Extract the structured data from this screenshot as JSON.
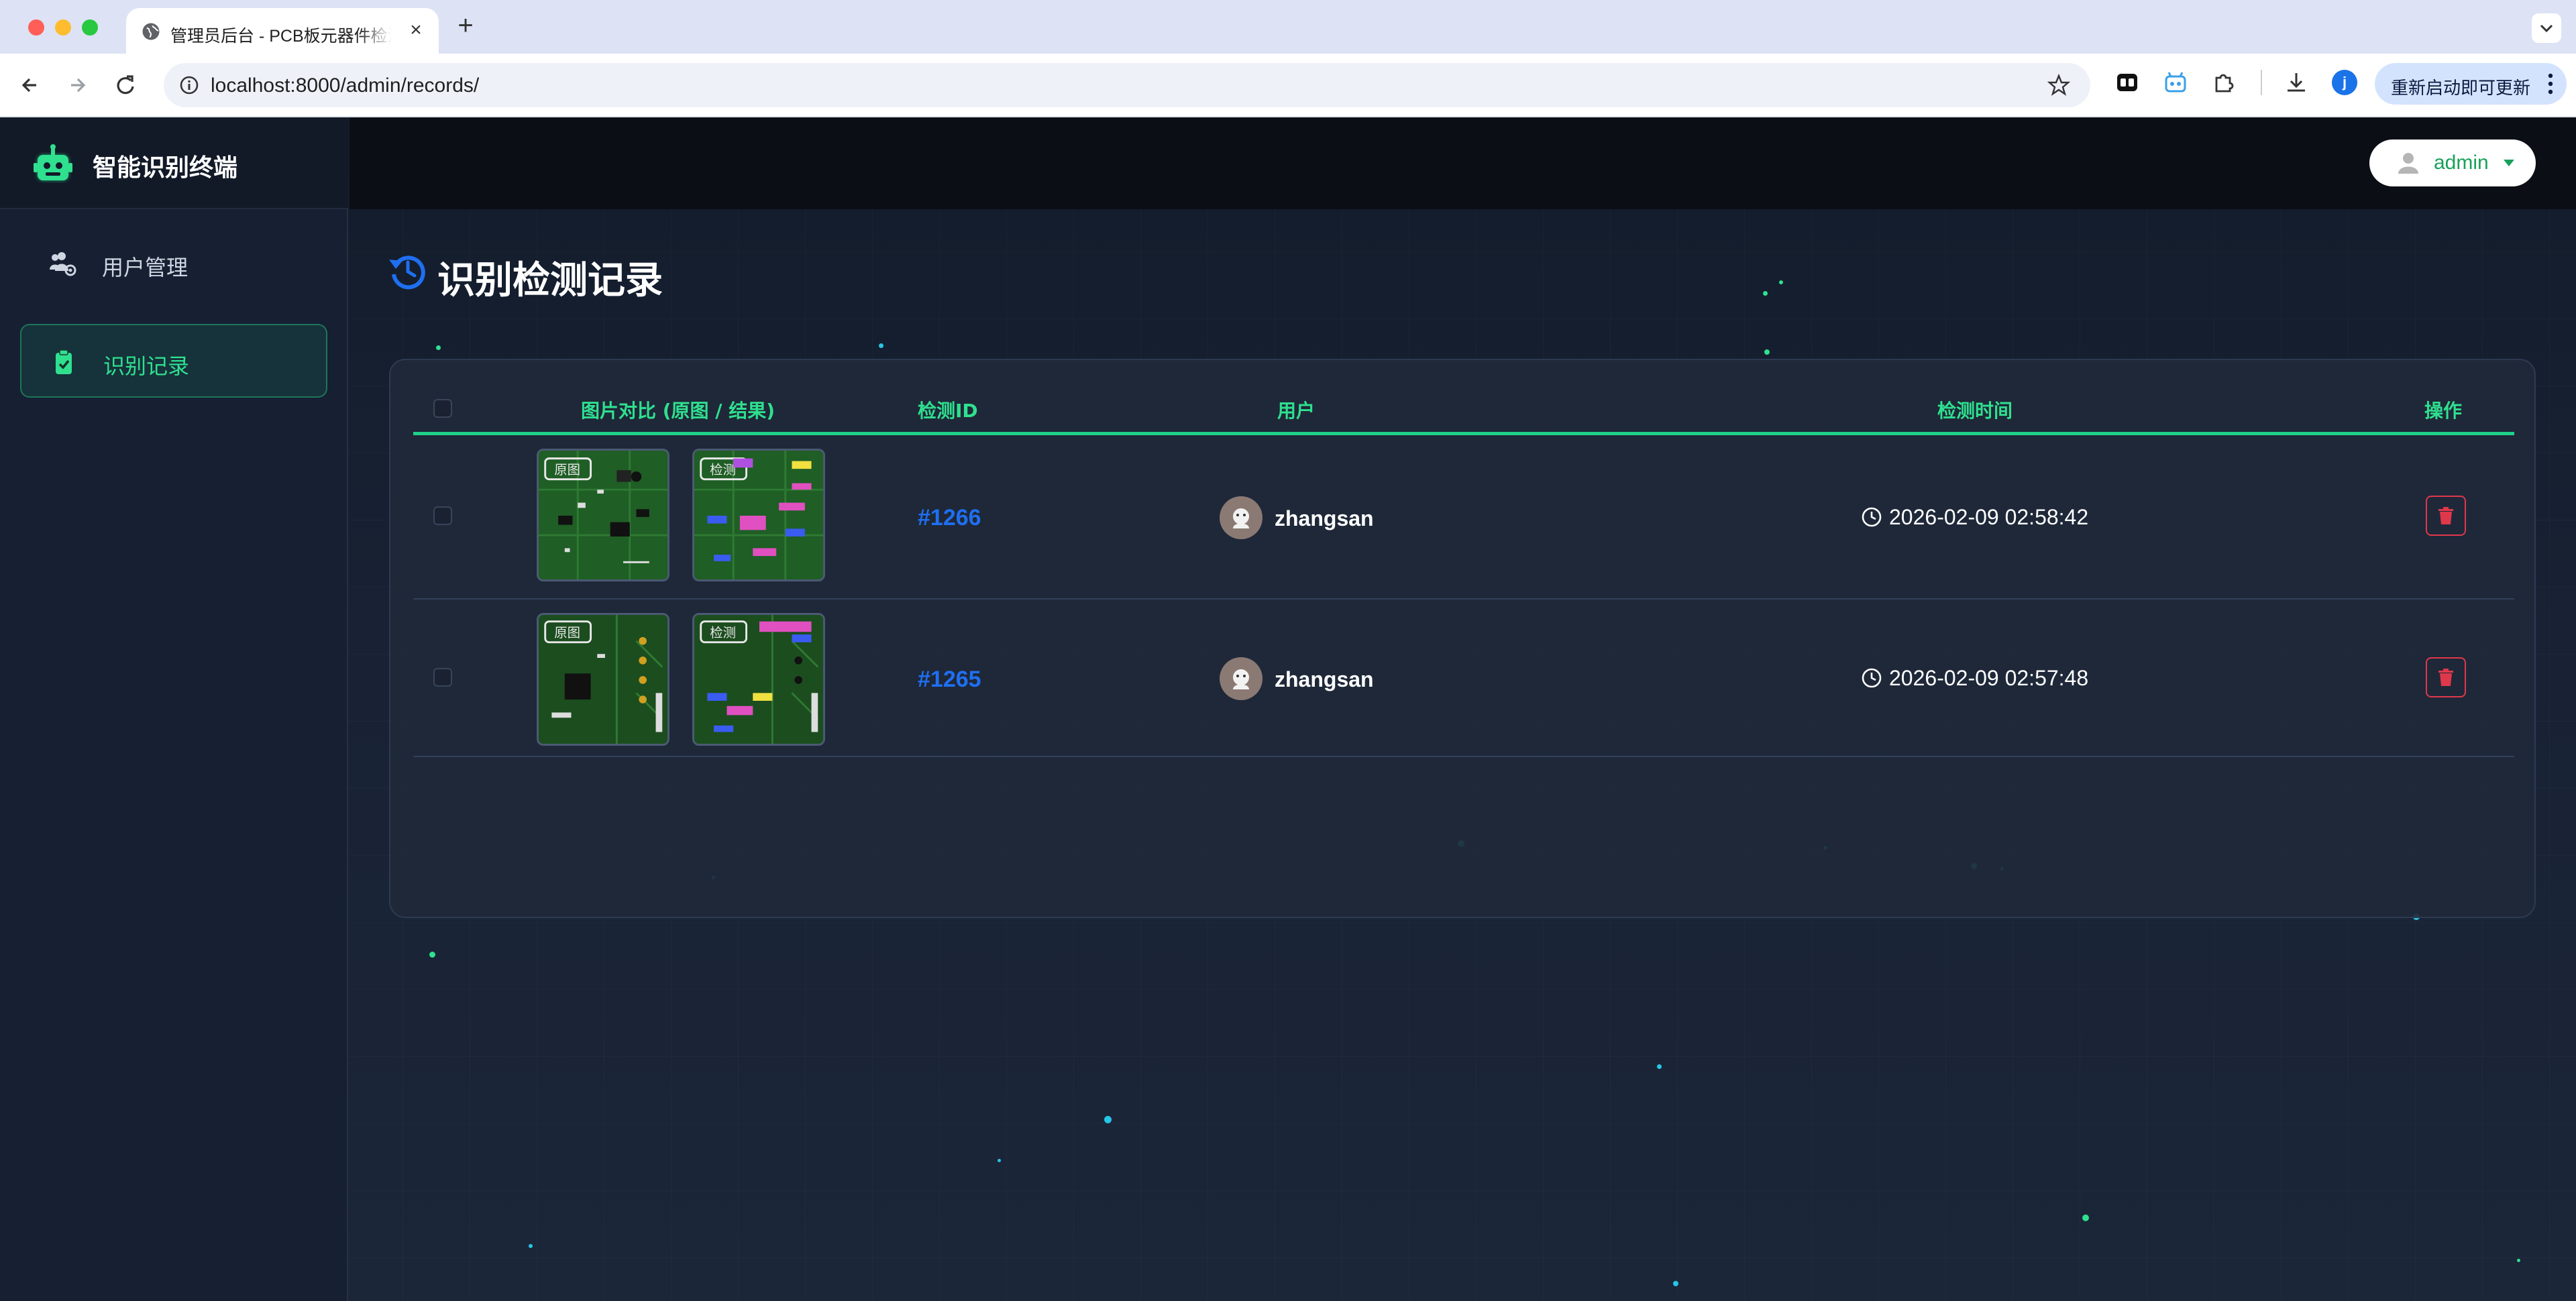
{
  "browser": {
    "tab_title": "管理员后台 - PCB板元器件检测系统",
    "url": "localhost:8000/admin/records/",
    "profile_initial": "j",
    "update_label": "重新启动即可更新"
  },
  "sidebar": {
    "brand": "智能识别终端",
    "items": [
      {
        "label": "用户管理",
        "icon": "users-gear-icon",
        "active": false
      },
      {
        "label": "识别记录",
        "icon": "clipboard-check-icon",
        "active": true
      }
    ]
  },
  "topbar": {
    "user": "admin"
  },
  "page": {
    "title": "识别检测记录",
    "title_icon": "history-icon"
  },
  "table": {
    "columns": {
      "images": "图片对比 (原图 / 结果)",
      "id": "检测ID",
      "user": "用户",
      "time": "检测时间",
      "actions": "操作"
    },
    "rows": [
      {
        "id": "#1266",
        "user": "zhangsan",
        "time": "2026-02-09 02:58:42",
        "original_tag": "原图",
        "result_tag": "检测"
      },
      {
        "id": "#1265",
        "user": "zhangsan",
        "time": "2026-02-09 02:57:48",
        "original_tag": "原图",
        "result_tag": "检测"
      }
    ]
  },
  "colors": {
    "accent_green": "#2fe08f",
    "id_blue": "#1f6ff0",
    "delete_red": "#e0384b",
    "background": "#182234"
  }
}
